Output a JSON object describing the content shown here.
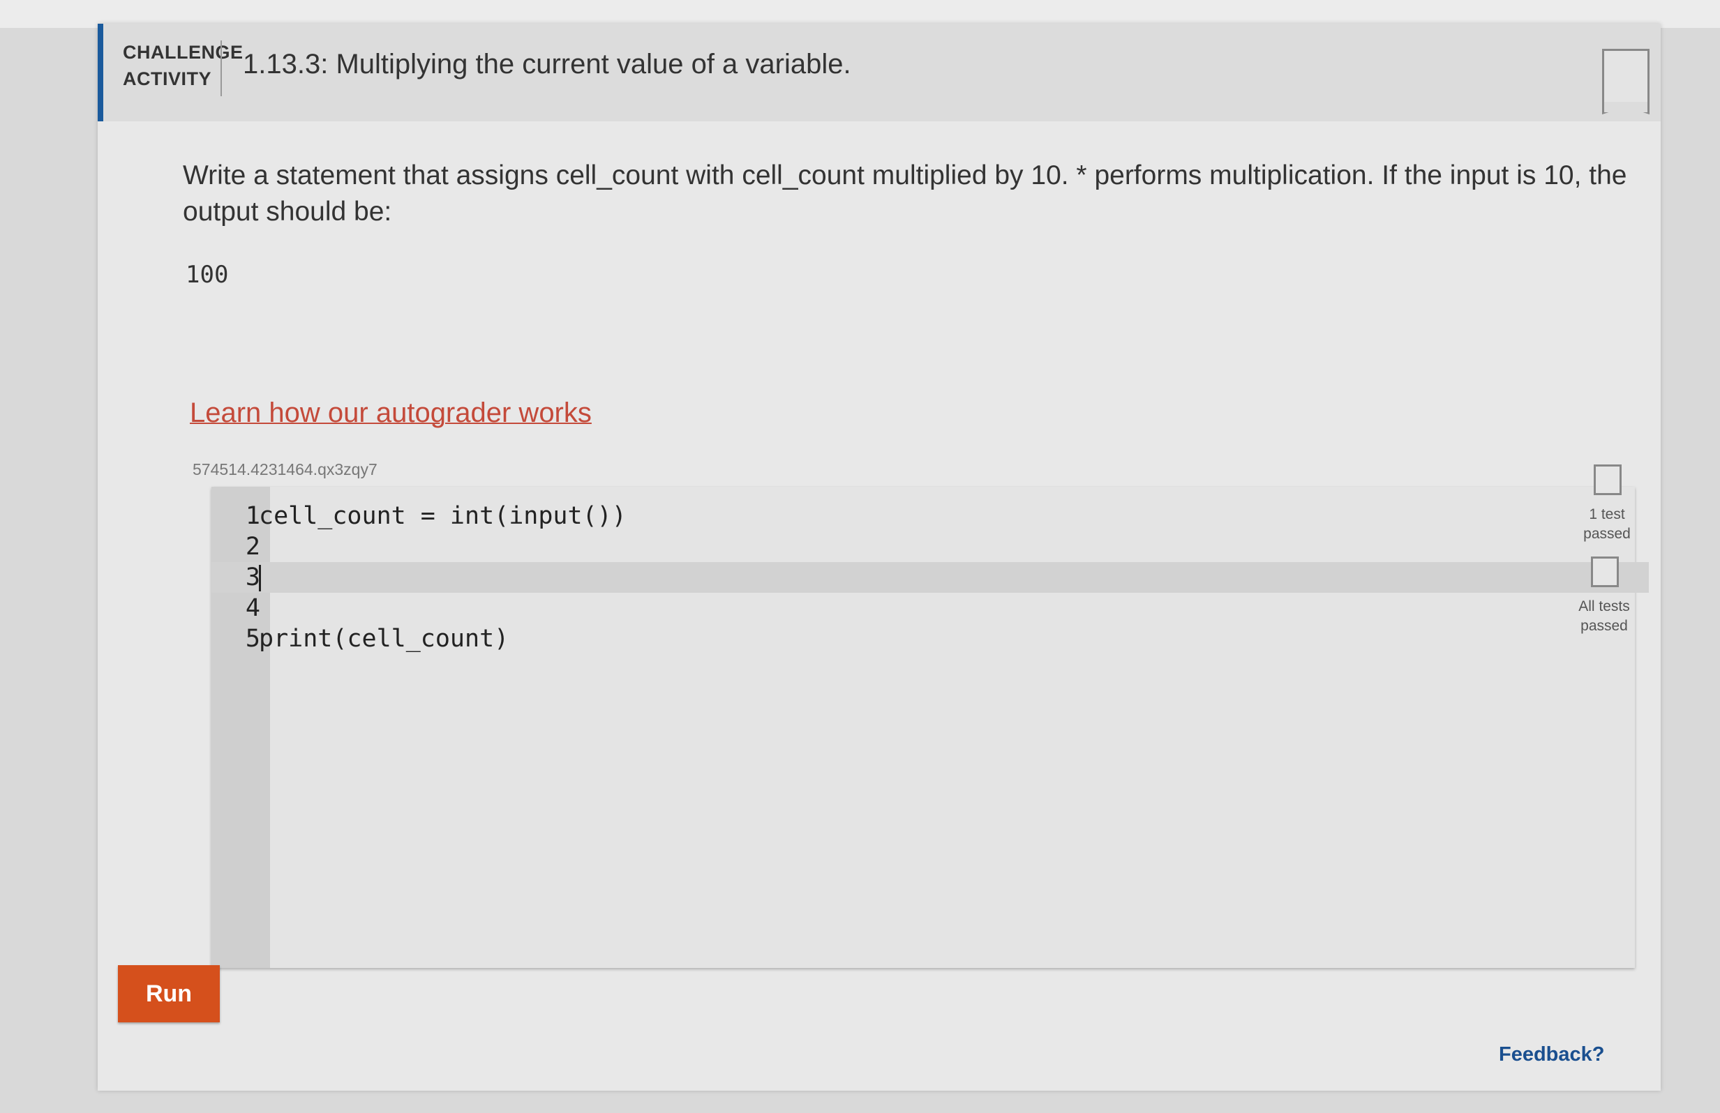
{
  "header": {
    "kind_line1": "CHALLENGE",
    "kind_line2": "ACTIVITY",
    "title": "1.13.3: Multiplying the current value of a variable."
  },
  "prompt": {
    "text": "Write a statement that assigns cell_count with cell_count multiplied by 10. * performs multiplication. If the input is 10, the output should be:",
    "expected_output": "100"
  },
  "autograder_link": "Learn how our autograder works",
  "code_id": "574514.4231464.qx3zqy7",
  "editor": {
    "lines": [
      {
        "number": "1",
        "code": "cell_count = int(input())"
      },
      {
        "number": "2",
        "code": ""
      },
      {
        "number": "3",
        "code": ""
      },
      {
        "number": "4",
        "code": ""
      },
      {
        "number": "5",
        "code": "print(cell_count)"
      }
    ],
    "active_line": 3
  },
  "tests": {
    "one_test_line1": "1 test",
    "one_test_line2": "passed",
    "all_tests_line1": "All tests",
    "all_tests_line2": "passed"
  },
  "run_label": "Run",
  "feedback_label": "Feedback?",
  "colors": {
    "accent_bar": "#1a5a9c",
    "run_button": "#d5501c",
    "link": "#c44a3a",
    "feedback": "#1a4f8f"
  }
}
